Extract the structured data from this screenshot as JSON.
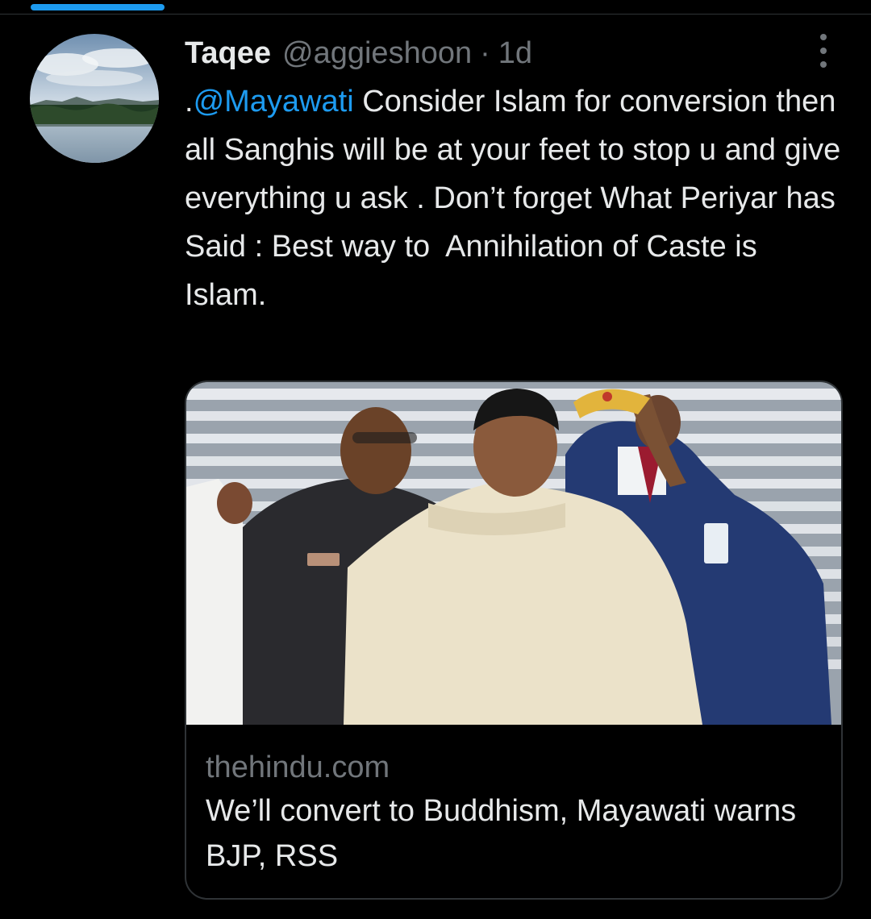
{
  "tweet": {
    "author": {
      "name": "Taqee",
      "handle": "@aggieshoon",
      "separator": "·",
      "time": "1d"
    },
    "text": {
      "prefix": ".",
      "mention": "@Mayawati",
      "rest": " Consider Islam for conversion then all Sanghis will be at your feet to stop u and give everything u ask . Don’t forget What Periyar has Said : Best way to  Annihilation of Caste is  Islam."
    },
    "card": {
      "domain": "thehindu.com",
      "title": "We’ll convert to Buddhism, Mayawati warns BJP, RSS"
    }
  },
  "icons": {
    "more": "more-vertical-icon"
  },
  "colors": {
    "background": "#000000",
    "accent": "#1d9bf0",
    "primary_text": "#e7e9ea",
    "secondary_text": "#71767b",
    "border": "#2f3336"
  }
}
